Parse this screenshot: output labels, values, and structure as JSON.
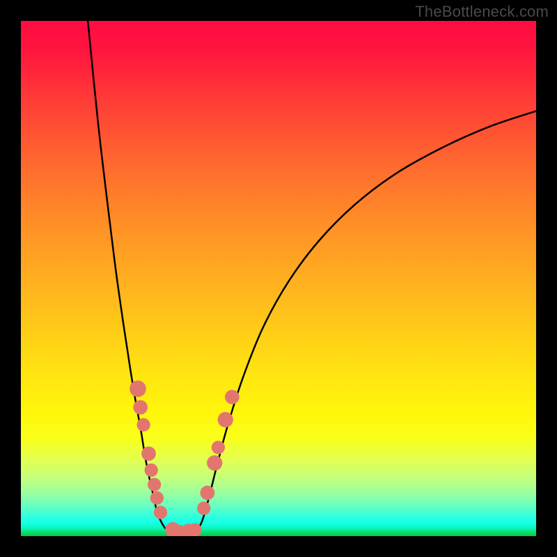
{
  "watermark": "TheBottleneck.com",
  "chart_data": {
    "type": "line",
    "title": "",
    "xlabel": "",
    "ylabel": "",
    "xlim": [
      0,
      100
    ],
    "ylim": [
      0,
      100
    ],
    "grid": false,
    "series": [
      {
        "name": "left-curve",
        "x": [
          13.0,
          15.0,
          17.0,
          18.5,
          20.0,
          21.3,
          22.3,
          23.3,
          24.1,
          25.0,
          25.8,
          26.5,
          27.8,
          29.0
        ],
        "y": [
          100.0,
          80.0,
          63.0,
          51.0,
          40.5,
          32.0,
          26.0,
          20.5,
          15.5,
          11.0,
          7.5,
          4.5,
          1.8,
          0.8
        ]
      },
      {
        "name": "valley-floor",
        "x": [
          29.0,
          30.0,
          31.0,
          32.0,
          33.0,
          34.0
        ],
        "y": [
          0.8,
          0.6,
          0.6,
          0.6,
          0.6,
          0.8
        ]
      },
      {
        "name": "right-curve",
        "x": [
          34.0,
          35.2,
          36.5,
          38.0,
          40.0,
          43.0,
          47.0,
          52.0,
          58.0,
          65.0,
          73.0,
          82.0,
          91.0,
          100.0
        ],
        "y": [
          0.8,
          3.0,
          7.5,
          13.5,
          21.0,
          30.5,
          40.5,
          49.5,
          57.5,
          64.5,
          70.5,
          75.5,
          79.5,
          82.5
        ]
      }
    ],
    "markers": {
      "name": "highlighted-points",
      "color": "#e2766e",
      "points": [
        {
          "x": 22.7,
          "y": 28.6,
          "r": 1.6
        },
        {
          "x": 23.2,
          "y": 25.0,
          "r": 1.4
        },
        {
          "x": 23.8,
          "y": 21.6,
          "r": 1.3
        },
        {
          "x": 24.8,
          "y": 16.0,
          "r": 1.4
        },
        {
          "x": 25.3,
          "y": 12.8,
          "r": 1.3
        },
        {
          "x": 25.9,
          "y": 10.0,
          "r": 1.3
        },
        {
          "x": 26.4,
          "y": 7.4,
          "r": 1.3
        },
        {
          "x": 27.1,
          "y": 4.6,
          "r": 1.3
        },
        {
          "x": 29.5,
          "y": 1.2,
          "r": 1.5
        },
        {
          "x": 30.7,
          "y": 0.9,
          "r": 1.3
        },
        {
          "x": 32.6,
          "y": 0.9,
          "r": 1.5
        },
        {
          "x": 33.8,
          "y": 1.2,
          "r": 1.3
        },
        {
          "x": 35.5,
          "y": 5.4,
          "r": 1.3
        },
        {
          "x": 36.2,
          "y": 8.4,
          "r": 1.4
        },
        {
          "x": 37.6,
          "y": 14.2,
          "r": 1.5
        },
        {
          "x": 38.3,
          "y": 17.2,
          "r": 1.3
        },
        {
          "x": 39.7,
          "y": 22.6,
          "r": 1.5
        },
        {
          "x": 41.0,
          "y": 27.0,
          "r": 1.4
        }
      ]
    }
  }
}
